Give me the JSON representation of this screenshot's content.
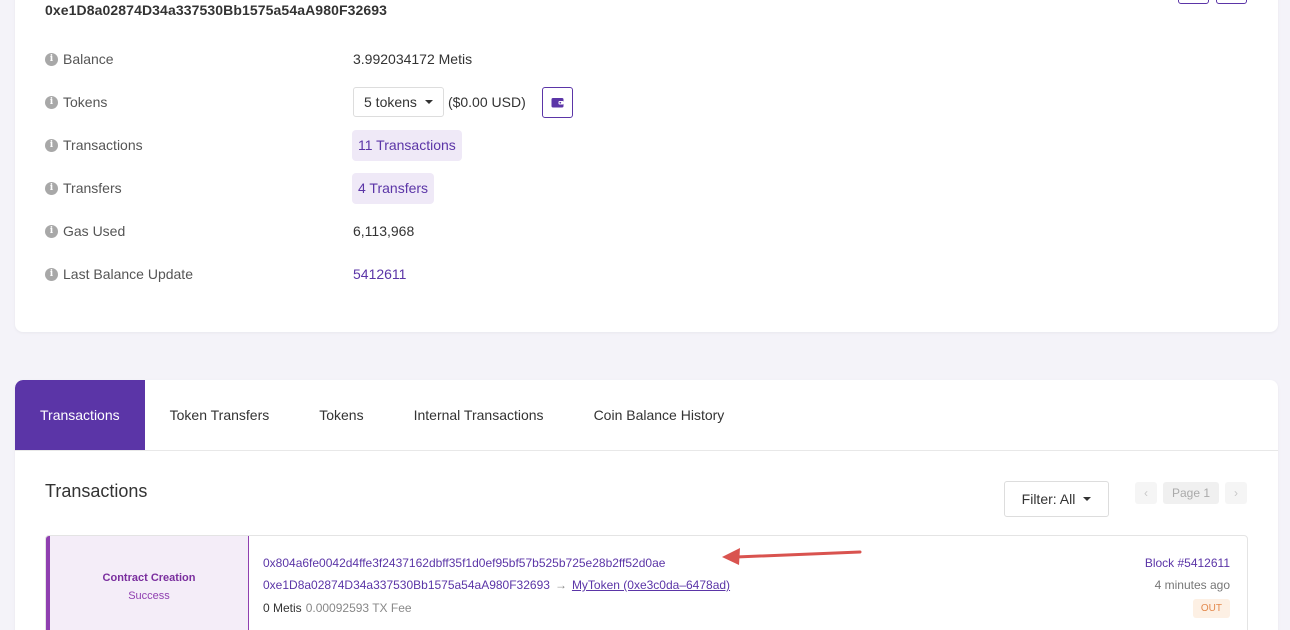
{
  "address": {
    "hash": "0xe1D8a02874D34a337530Bb1575a54aA980F32693",
    "rows": {
      "balance": {
        "label": "Balance",
        "value": "3.992034172 Metis"
      },
      "tokens": {
        "label": "Tokens",
        "dropdown": "5 tokens",
        "usd": "($0.00 USD)"
      },
      "transactions": {
        "label": "Transactions",
        "value": "11 Transactions"
      },
      "transfers": {
        "label": "Transfers",
        "value": "4 Transfers"
      },
      "gas_used": {
        "label": "Gas Used",
        "value": "6,113,968"
      },
      "last_balance_update": {
        "label": "Last Balance Update",
        "value": "5412611"
      }
    }
  },
  "tabs": [
    {
      "label": "Transactions",
      "active": true
    },
    {
      "label": "Token Transfers"
    },
    {
      "label": "Tokens"
    },
    {
      "label": "Internal Transactions"
    },
    {
      "label": "Coin Balance History"
    }
  ],
  "list": {
    "title": "Transactions",
    "filter_label": "Filter: All",
    "pager": {
      "page_label": "Page 1"
    }
  },
  "transaction": {
    "type": "Contract Creation",
    "status": "Success",
    "hash": "0x804a6fe0042d4ffe3f2437162dbff35f1d0ef95bf57b525b725e28b2ff52d0ae",
    "from": "0xe1D8a02874D34a337530Bb1575a54aA980F32693",
    "arrow": "→",
    "to": "MyToken (0xe3c0da–6478ad)",
    "value": "0 Metis",
    "fee": "0.00092593 TX Fee",
    "block": "Block #5412611",
    "time": "4 minutes ago",
    "direction": "OUT"
  },
  "colors": {
    "accent": "#5b35a7",
    "page_bg": "#f4f3f9",
    "annotation_arrow": "#d9534f"
  }
}
